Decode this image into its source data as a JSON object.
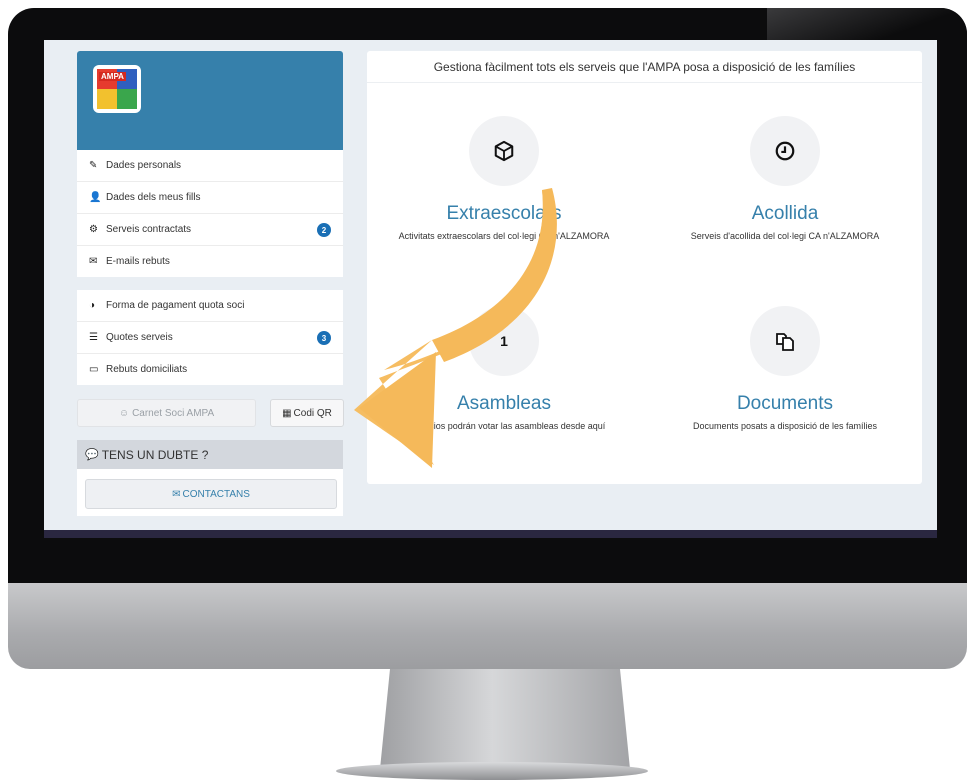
{
  "sidebar": {
    "logo_text": "AMPA",
    "menu1": [
      {
        "label": "Dades personals",
        "icon": "edit-icon"
      },
      {
        "label": "Dades dels meus fills",
        "icon": "user-icon"
      },
      {
        "label": "Serveis contractats",
        "icon": "gear-icon",
        "badge": "2"
      },
      {
        "label": "E-mails rebuts",
        "icon": "envelope-icon"
      }
    ],
    "menu2": [
      {
        "label": "Forma de pagament quota soci",
        "icon": "half-circle-icon"
      },
      {
        "label": "Quotes serveis",
        "icon": "list-icon",
        "badge": "3"
      },
      {
        "label": "Rebuts domiciliats",
        "icon": "credit-card-icon"
      }
    ],
    "carnet_label": "Carnet Soci AMPA",
    "qr_label": "Codi QR",
    "help_title": "TENS UN DUBTE ?",
    "contact_label": "CONTACTANS"
  },
  "main": {
    "header": "Gestiona fàcilment tots els serveis que l'AMPA posa a disposició de les famílies",
    "services": [
      {
        "title": "Extraescolars",
        "desc": "Activitats extraescolars del col·legi CA n'ALZAMORA",
        "icon": "cube-icon"
      },
      {
        "title": "Acollida",
        "desc": "Serveis d'acollida del col·legi CA n'ALZAMORA",
        "icon": "clock-icon"
      },
      {
        "title": "Asambleas",
        "desc": "Los socios podrán votar las asambleas desde aquí",
        "icon": "vote-icon"
      },
      {
        "title": "Documents",
        "desc": "Documents posats a disposició de les famílies",
        "icon": "documents-icon"
      }
    ]
  },
  "colors": {
    "brand_blue": "#3680ab",
    "badge_blue": "#1a6fb5",
    "arrow_orange": "#f5b95a"
  }
}
